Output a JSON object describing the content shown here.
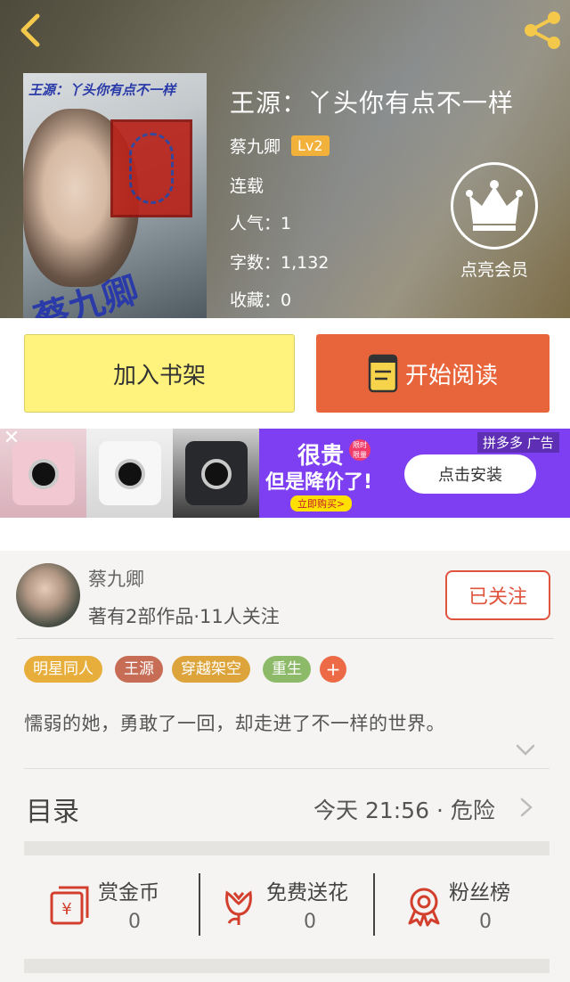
{
  "book": {
    "title": "王源：丫头你有点不一样",
    "author": "蔡九卿",
    "author_level": "Lv2",
    "status": "连载",
    "popularity": "人气：1",
    "word_count": "字数：1,132",
    "favorites": "收藏：0",
    "cover_title": "王源：丫头你有点不一样",
    "cover_author": "蔡九卿"
  },
  "vip": {
    "label": "点亮会员"
  },
  "actions": {
    "add_shelf": "加入书架",
    "start_reading": "开始阅读"
  },
  "ad": {
    "close": "✕",
    "source": "拼多多 广告",
    "headline": "很贵",
    "limited": "限时 限量",
    "subline": "但是降价了!",
    "buy_now": "立即购买>",
    "install": "点击安装"
  },
  "author_card": {
    "name": "蔡九卿",
    "meta": "著有2部作品·11人关注",
    "follow_label": "已关注"
  },
  "tags": [
    "明星同人",
    "王源",
    "穿越架空",
    "重生"
  ],
  "tag_add": "+",
  "description": "懦弱的她，勇敢了一回，却走进了不一样的世界。",
  "toc": {
    "label": "目录",
    "latest": "今天 21:56 · 危险"
  },
  "stats": [
    {
      "name": "赏金币",
      "count": "0"
    },
    {
      "name": "免费送花",
      "count": "0"
    },
    {
      "name": "粉丝榜",
      "count": "0"
    }
  ],
  "colors": {
    "accent": "#e8653c",
    "shelf_button": "#fff27d",
    "follow": "#e0533d",
    "ad_background": "#7e3ff2",
    "level_badge": "#f1b13b"
  }
}
